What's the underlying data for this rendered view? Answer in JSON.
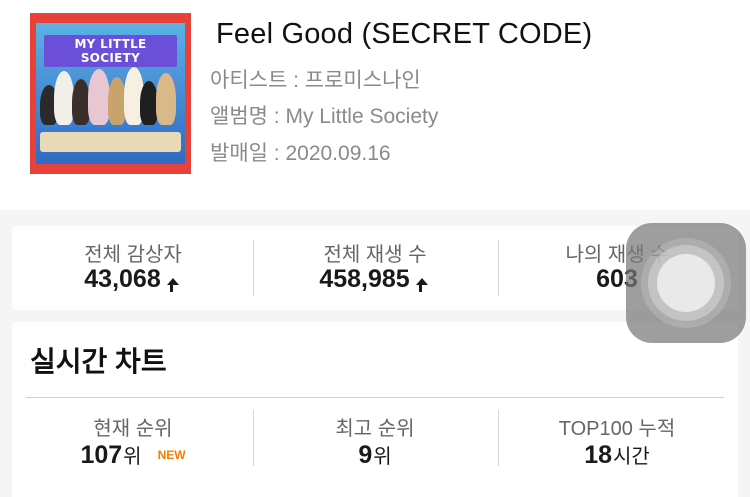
{
  "song": {
    "title": "Feel Good (SECRET CODE)",
    "artist_line": "아티스트 : 프로미스나인",
    "album_line": "앨범명 : My Little Society",
    "release_line": "발매일 : 2020.09.16",
    "album_art": {
      "logo_text": "MY LITTLE SOCIETY",
      "accent_color": "#e7423a"
    }
  },
  "stats": [
    {
      "label": "전체 감상자",
      "value": "43,068",
      "trend": "up"
    },
    {
      "label": "전체 재생 수",
      "value": "458,985",
      "trend": "up"
    },
    {
      "label": "나의 재생 수",
      "value": "603",
      "trend": "none"
    }
  ],
  "chart": {
    "title": "실시간 차트",
    "items": [
      {
        "label": "현재 순위",
        "value": "107",
        "unit": "위",
        "badge": "NEW"
      },
      {
        "label": "최고 순위",
        "value": "9",
        "unit": "위"
      },
      {
        "label": "TOP100 누적",
        "value": "18",
        "unit": "시간"
      }
    ]
  },
  "colors": {
    "new_badge": "#ff7a00",
    "background": "#f4f5f7"
  },
  "overlay": {
    "icon": "assistive-touch-icon"
  }
}
